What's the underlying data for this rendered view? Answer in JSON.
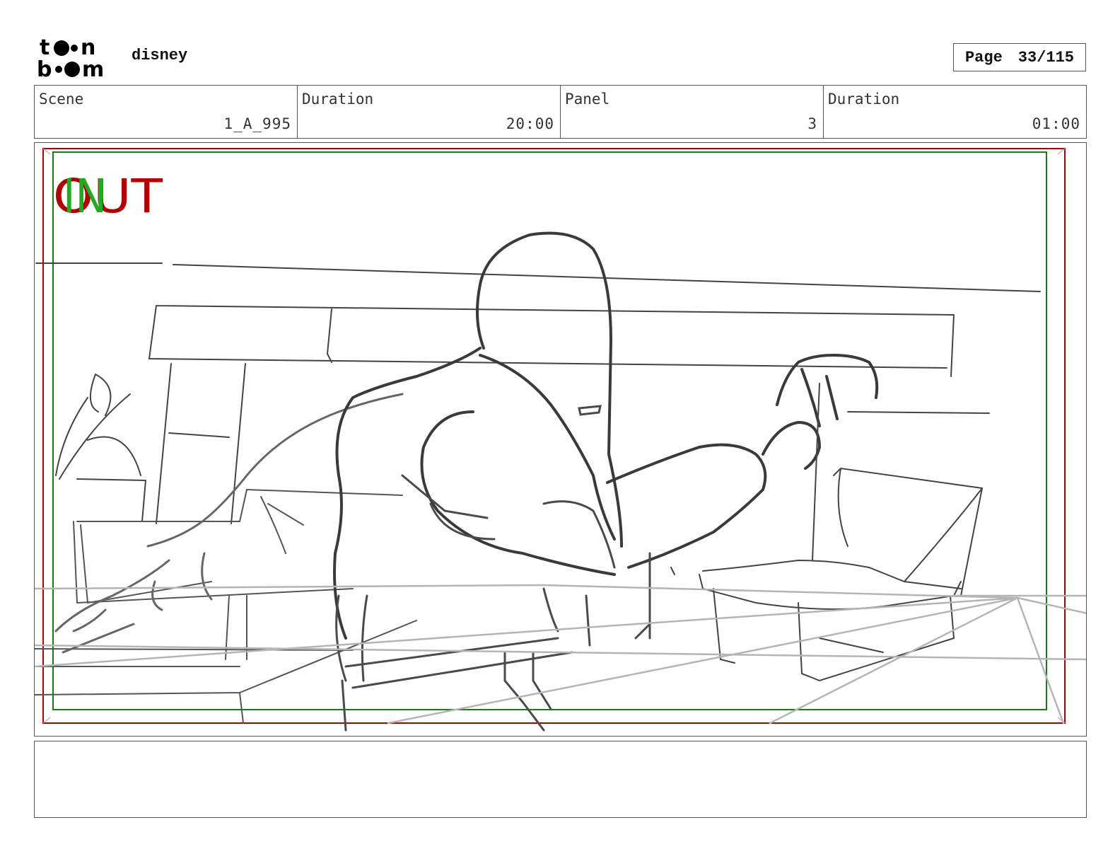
{
  "header": {
    "logo_icon": "toonboom-logo",
    "project": "disney",
    "page_label": "Page",
    "page_value": "33/115"
  },
  "info": [
    {
      "label": "Scene",
      "value": "1_A_995"
    },
    {
      "label": "Duration",
      "value": "20:00"
    },
    {
      "label": "Panel",
      "value": "3"
    },
    {
      "label": "Duration",
      "value": "01:00"
    }
  ],
  "panel": {
    "out_mark": "OUT",
    "in_mark": "IN",
    "out_color": "#b00000",
    "in_color": "#22aa22",
    "safe_frame_color": "#b00000",
    "title_safe_color": "#1a7a1a"
  },
  "notes": ""
}
